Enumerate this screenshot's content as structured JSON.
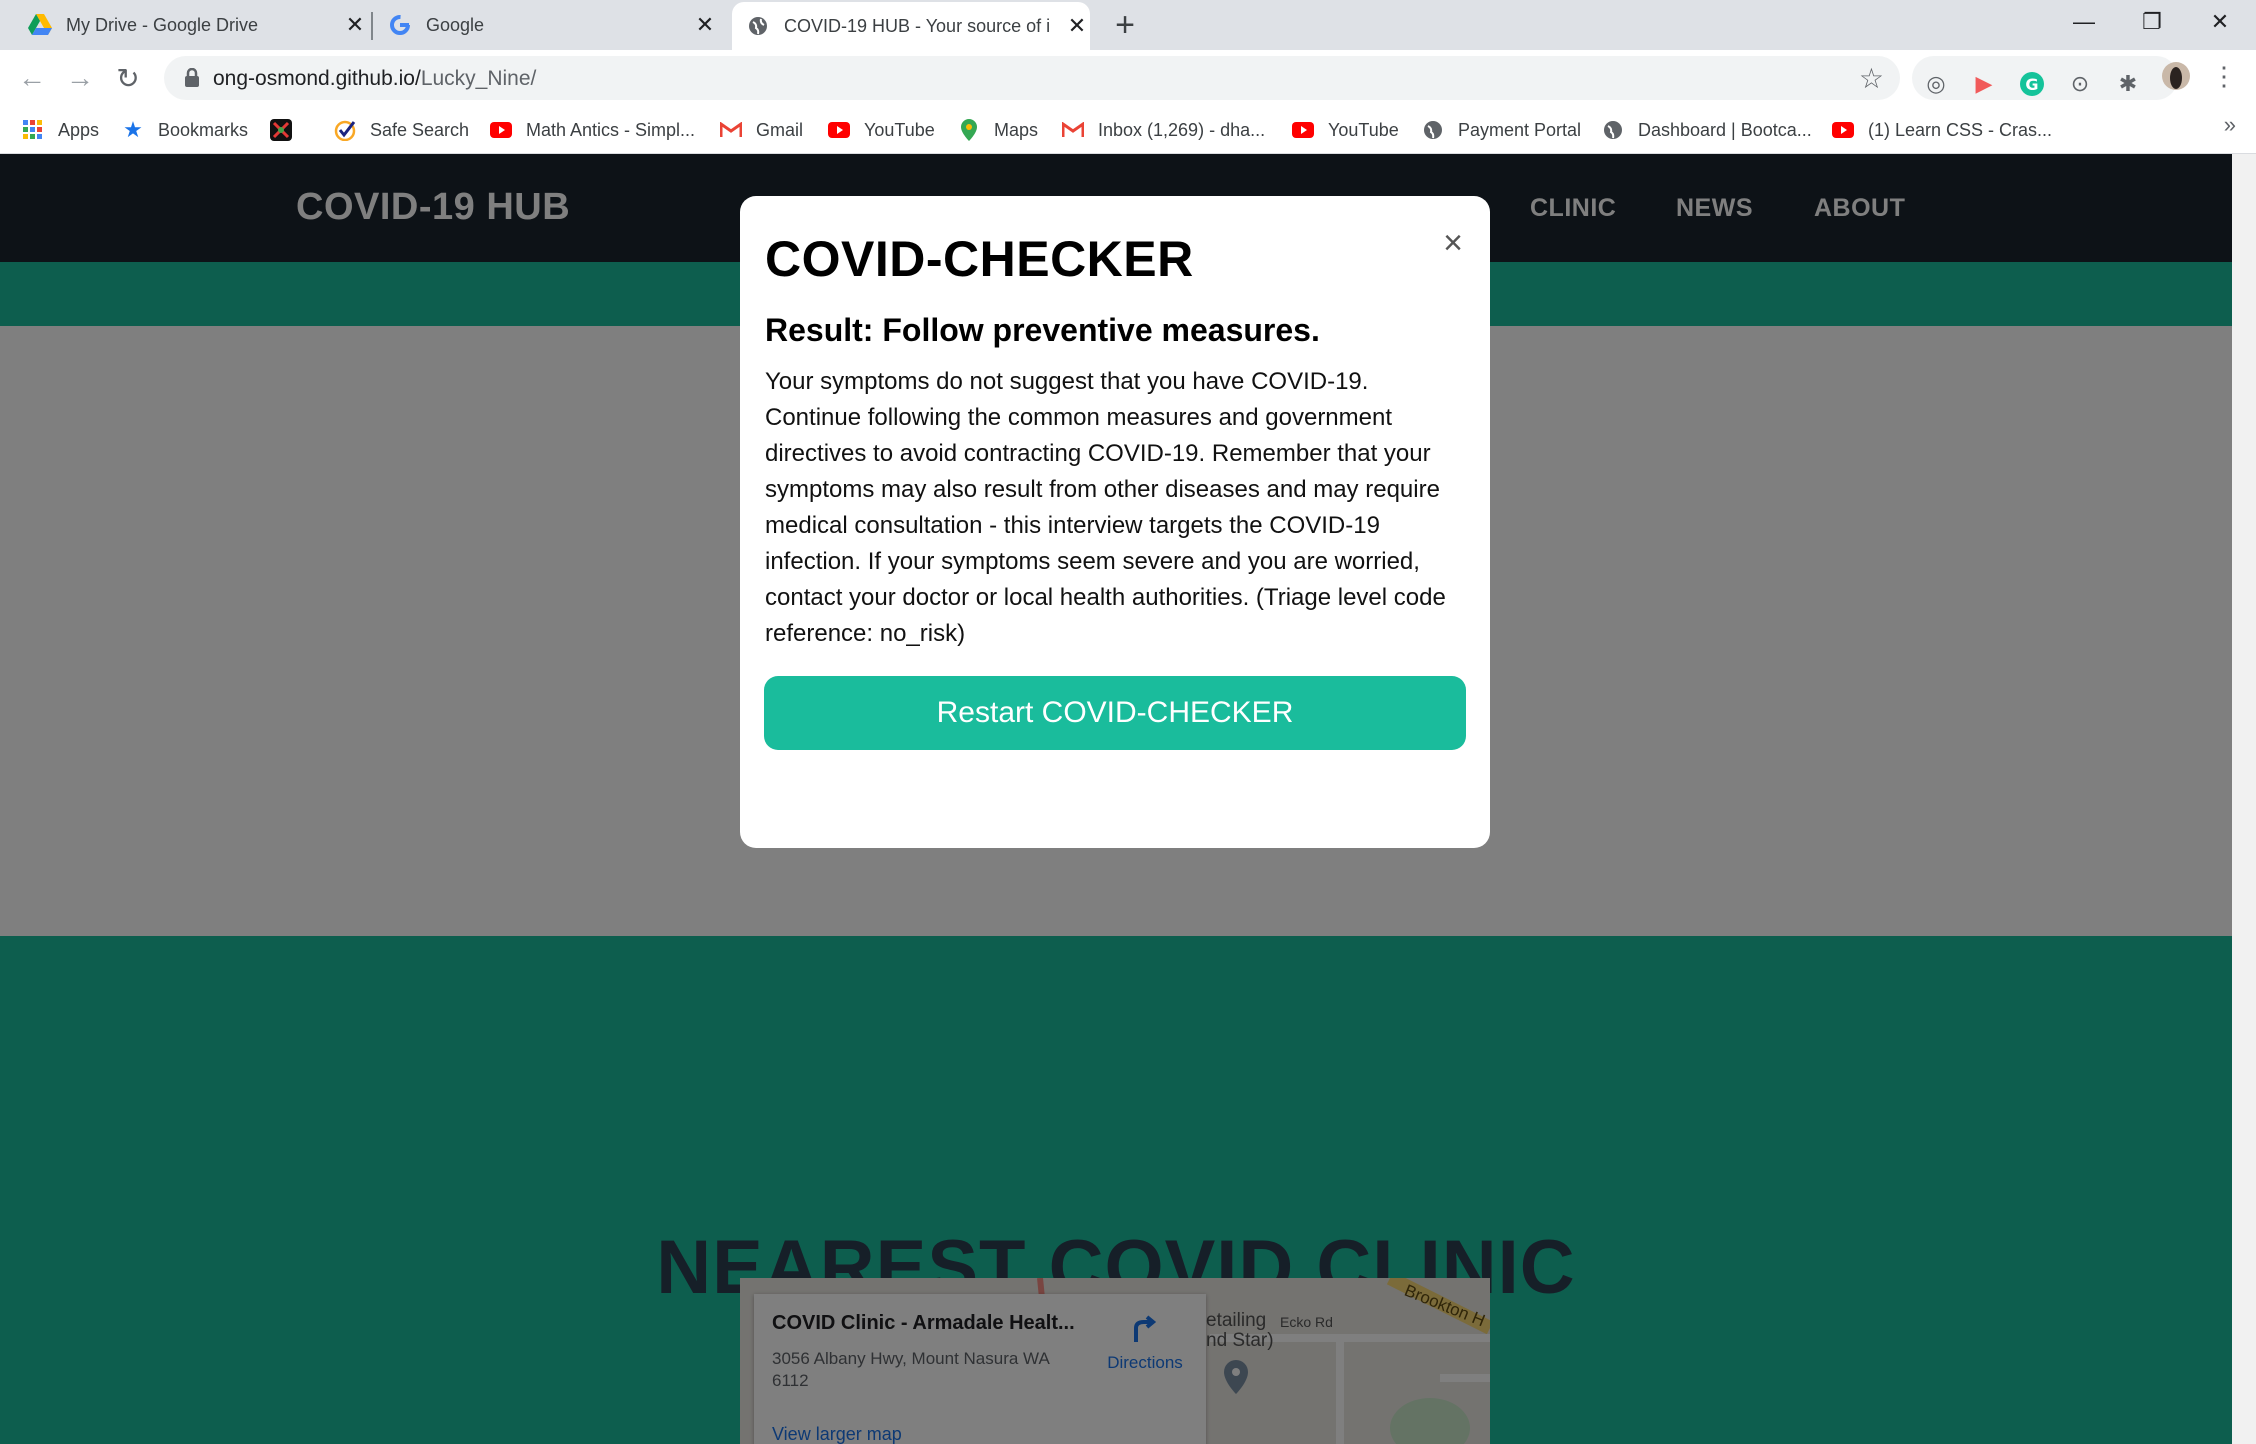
{
  "browser": {
    "tabs": [
      {
        "title": "My Drive - Google Drive"
      },
      {
        "title": "Google"
      },
      {
        "title": "COVID-19 HUB - Your source of i"
      }
    ],
    "url_host": "ong-osmond.github.io/",
    "url_path": "Lucky_Nine/",
    "bookmarks": [
      {
        "label": "Apps"
      },
      {
        "label": "Bookmarks"
      },
      {
        "label": "Safe Search"
      },
      {
        "label": "Math Antics - Simpl..."
      },
      {
        "label": "Gmail"
      },
      {
        "label": "YouTube"
      },
      {
        "label": "Maps"
      },
      {
        "label": "Inbox (1,269) - dha..."
      },
      {
        "label": "YouTube"
      },
      {
        "label": "Payment Portal"
      },
      {
        "label": "Dashboard | Bootca..."
      },
      {
        "label": "(1) Learn CSS - Cras..."
      }
    ],
    "overflow_glyph": "»"
  },
  "site": {
    "brand": "COVID-19 HUB",
    "nav": [
      "CLINIC",
      "NEWS",
      "ABOUT"
    ],
    "section_title": "NEAREST COVID CLINIC"
  },
  "map": {
    "place_name": "COVID Clinic - Armadale Healt...",
    "address": "3056 Albany Hwy, Mount Nasura WA 6112",
    "directions_label": "Directions",
    "view_larger": "View larger map",
    "street_labels": [
      "Brookton H",
      "Ecko Rd",
      "etailing",
      "nd Star)"
    ]
  },
  "modal": {
    "title": "COVID-CHECKER",
    "close_glyph": "×",
    "result": "Result: Follow preventive measures.",
    "description": "Your symptoms do not suggest that you have COVID-19. Continue following the common measures and government directives to avoid contracting COVID-19. Remember that your symptoms may also result from other diseases and may require medical consultation - this interview targets the COVID-19 infection. If your symptoms seem severe and you are worried, contact your doctor or local health authorities. (Triage level code reference: no_risk)",
    "button": "Restart COVID-CHECKER"
  },
  "colors": {
    "navbar": "#1a252f",
    "teal": "#1abc9c",
    "dark_text": "#2c3e50"
  }
}
